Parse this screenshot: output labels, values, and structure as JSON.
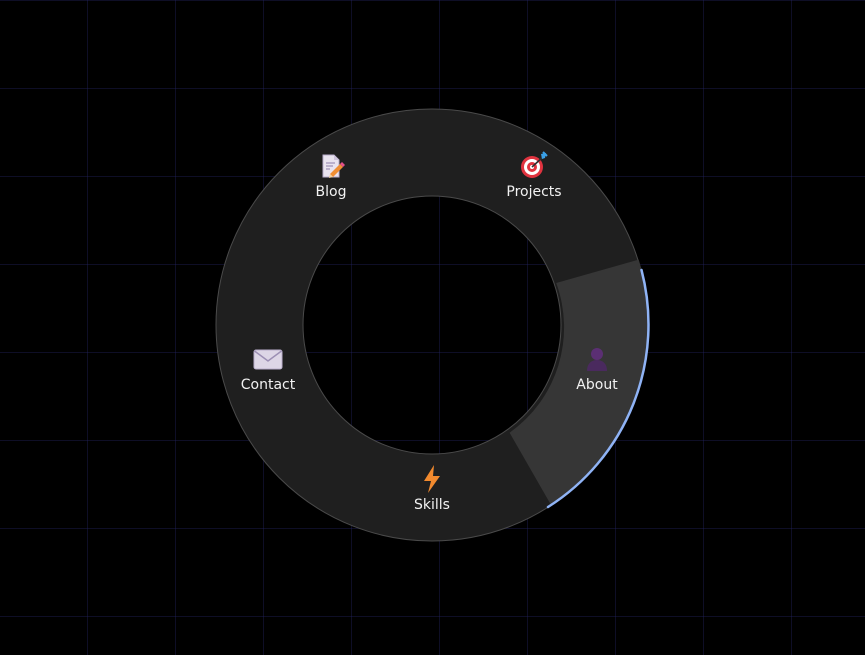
{
  "menu": {
    "active_item": "About",
    "accent_color": "#8fb3f5",
    "items": [
      {
        "label": "Blog",
        "icon": "memo-pencil-icon"
      },
      {
        "label": "Projects",
        "icon": "target-dart-icon"
      },
      {
        "label": "About",
        "icon": "person-silhouette-icon"
      },
      {
        "label": "Skills",
        "icon": "lightning-bolt-icon"
      },
      {
        "label": "Contact",
        "icon": "envelope-icon"
      }
    ]
  }
}
